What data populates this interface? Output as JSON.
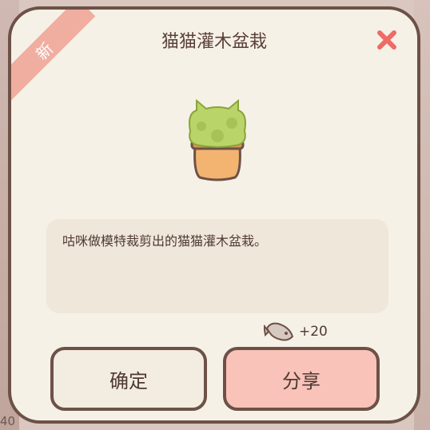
{
  "background": {
    "partial_text": "40"
  },
  "dialog": {
    "badge": "新",
    "title": "猫猫灌木盆栽",
    "close_icon": "close-x-icon",
    "item_icon": "cat-bush-bonsai-icon",
    "description": "咕咪做模特裁剪出的猫猫灌木盆栽。",
    "reward": {
      "icon": "fish-icon",
      "amount": "+20"
    },
    "buttons": {
      "confirm": "确定",
      "share": "分享"
    }
  },
  "colors": {
    "card_bg": "#f6f1e7",
    "border": "#6d5147",
    "badge_bg": "#f0aea1",
    "close_x": "#ee6b67",
    "share_bg": "#f9c3b9",
    "desc_bg": "#efe7da"
  }
}
